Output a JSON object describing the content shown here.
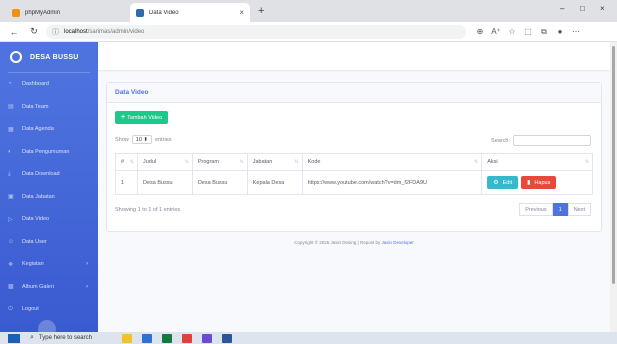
{
  "browser": {
    "tabs": [
      {
        "label": "phpMyAdmin",
        "favicon_color": "#f29111"
      },
      {
        "label": "Data Video",
        "favicon_color": "#2b6cb0"
      }
    ],
    "url_host": "localhost",
    "url_path": "/sarimas/admin/video",
    "icons": {
      "new_tab": "+",
      "back": "←",
      "reload": "↻",
      "info": "ⓘ",
      "close": "×",
      "minimize": "–",
      "maximize": "□",
      "window_close": "×",
      "zoom": "⊕",
      "read_aloud": "A⁺",
      "favorite": "☆",
      "split": "⬚",
      "collections": "⧉",
      "profile": "●",
      "more": "⋯"
    }
  },
  "sidebar": {
    "brand": "DESA BUSSU",
    "items": [
      {
        "label": "Dashboard",
        "icon": "◔"
      },
      {
        "label": "Data Team",
        "icon": "▤"
      },
      {
        "label": "Data Agenda",
        "icon": "▦"
      },
      {
        "label": "Data Pengumuman",
        "icon": "◐"
      },
      {
        "label": "Data Download",
        "icon": "⤓"
      },
      {
        "label": "Data Jabatan",
        "icon": "▣"
      },
      {
        "label": "Data Video",
        "icon": "▷"
      },
      {
        "label": "Data User",
        "icon": "☺"
      },
      {
        "label": "Kegiatan",
        "icon": "❖",
        "chevron": "›"
      },
      {
        "label": "Album Galeri",
        "icon": "▩",
        "chevron": "›"
      },
      {
        "label": "Logout",
        "icon": "⏻"
      }
    ]
  },
  "card": {
    "title": "Data Video",
    "add_label": "Tambah Video",
    "add_icon": "+",
    "show_prefix": "Show",
    "show_value": "10",
    "show_suffix": "entries",
    "search_label": "Search:",
    "columns": [
      "#",
      "Judul",
      "Program",
      "Jabatan",
      "Kode",
      "Aksi"
    ],
    "sort_icon": "⇅",
    "rows": [
      {
        "no": "1",
        "judul": "Desa Bussu",
        "program": "Desa Bussu",
        "jabatan": "Kepala Desa",
        "kode": "https://www.youtube.com/watch?v=dm_f2FDA9U",
        "edit_label": "Edit",
        "edit_icon": "⚙",
        "delete_label": "Hapus",
        "delete_icon": "▮"
      }
    ],
    "info": "Showing 1 to 1 of 1 entries",
    "pagination": {
      "previous": "Previous",
      "current": "1",
      "next": "Next"
    }
  },
  "footer": {
    "text": "Copyright © 2025 Jasin Desing | Repost by",
    "author": "Jasin Developer"
  },
  "taskbar": {
    "search_placeholder": "Type here to search",
    "search_icon": "⌕",
    "apps": [
      "#f2c12e",
      "#2f6fd6",
      "#0f7b3f",
      "#e0403a",
      "#6a4bd6",
      "#2b579a"
    ]
  }
}
